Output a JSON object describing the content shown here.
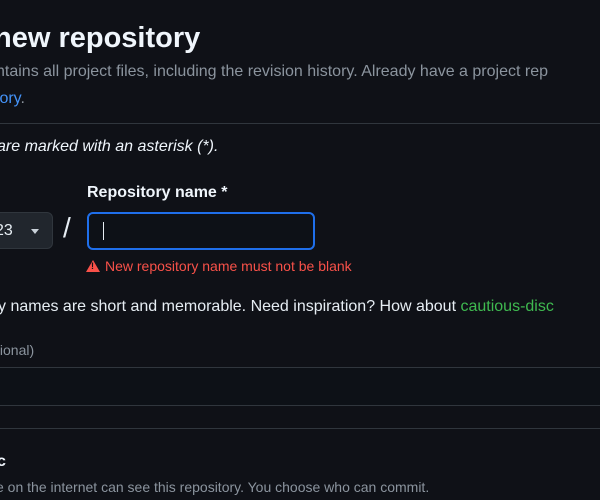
{
  "header": {
    "title": "new repository",
    "subtitle": "ntains all project files, including the revision history. Already have a project rep",
    "import_link": "tory",
    "import_link_suffix": "."
  },
  "form": {
    "required_note": "are marked with an asterisk (*).",
    "owner_value": "23",
    "separator": "/",
    "name_label": "Repository name *",
    "name_value": "",
    "error": "New repository name must not be blank",
    "help_text": "y names are short and memorable. Need inspiration? How about ",
    "suggestion": "cautious-disc",
    "description_label": "tional)",
    "description_value": "",
    "visibility": {
      "public_label": "c",
      "public_desc": "e on the internet can see this repository. You choose who can commit."
    }
  },
  "colors": {
    "accent": "#1f6feb",
    "error": "#f85149",
    "success": "#3fb950",
    "link": "#4493f8"
  }
}
